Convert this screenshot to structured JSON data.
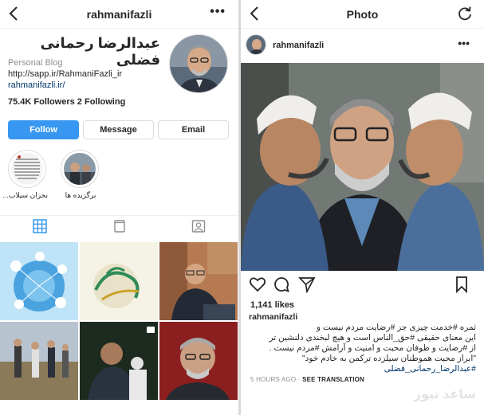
{
  "left": {
    "header": {
      "username": "rahmanifazli"
    },
    "profile": {
      "display_name": "عبدالرضا رحمانی فضلی",
      "category": "Personal Blog",
      "bio_line": "http://sapp.ir/RahmaniFazli_ir",
      "website": "rahmanifazli.ir/",
      "stats": "75.4K Followers  2 Following"
    },
    "buttons": {
      "follow": "Follow",
      "message": "Message",
      "email": "Email"
    },
    "highlights": [
      {
        "label": "بحران سیلاب..."
      },
      {
        "label": "برگزیده ها"
      }
    ]
  },
  "right": {
    "header": {
      "title": "Photo"
    },
    "post": {
      "username": "rahmanifazli",
      "likes": "1,141 likes",
      "caption_user": "rahmanifazli",
      "caption_lines": [
        "ثمره #خدمت چیزی جز #رضایت مردم نیست و",
        "این معنای حقیقی #حق_الناس است و هیچ لبخندی دلنشین تر",
        "از #رضایت و طوفان محبت و امنیت و آرامش #مردم نیست .",
        "\"ابراز محبت هموطنان سیلزده ترکمن به خادم خود\"",
        "#عبدالرضا_رحمانی_فضلی"
      ],
      "time": "5 HOURS AGO",
      "translation": "SEE TRANSLATION"
    },
    "watermark": "ساعد نیوز"
  },
  "icons": {
    "back": "chevron-left-icon",
    "more": "more-horizontal-icon",
    "refresh": "refresh-icon",
    "grid": "grid-icon",
    "igtv": "igtv-icon",
    "tagged": "tagged-icon",
    "like": "heart-icon",
    "comment": "comment-icon",
    "share": "paper-plane-icon",
    "save": "bookmark-icon"
  },
  "colors": {
    "accent": "#3897f0",
    "link": "#00376b",
    "muted": "#8e8e8e"
  }
}
